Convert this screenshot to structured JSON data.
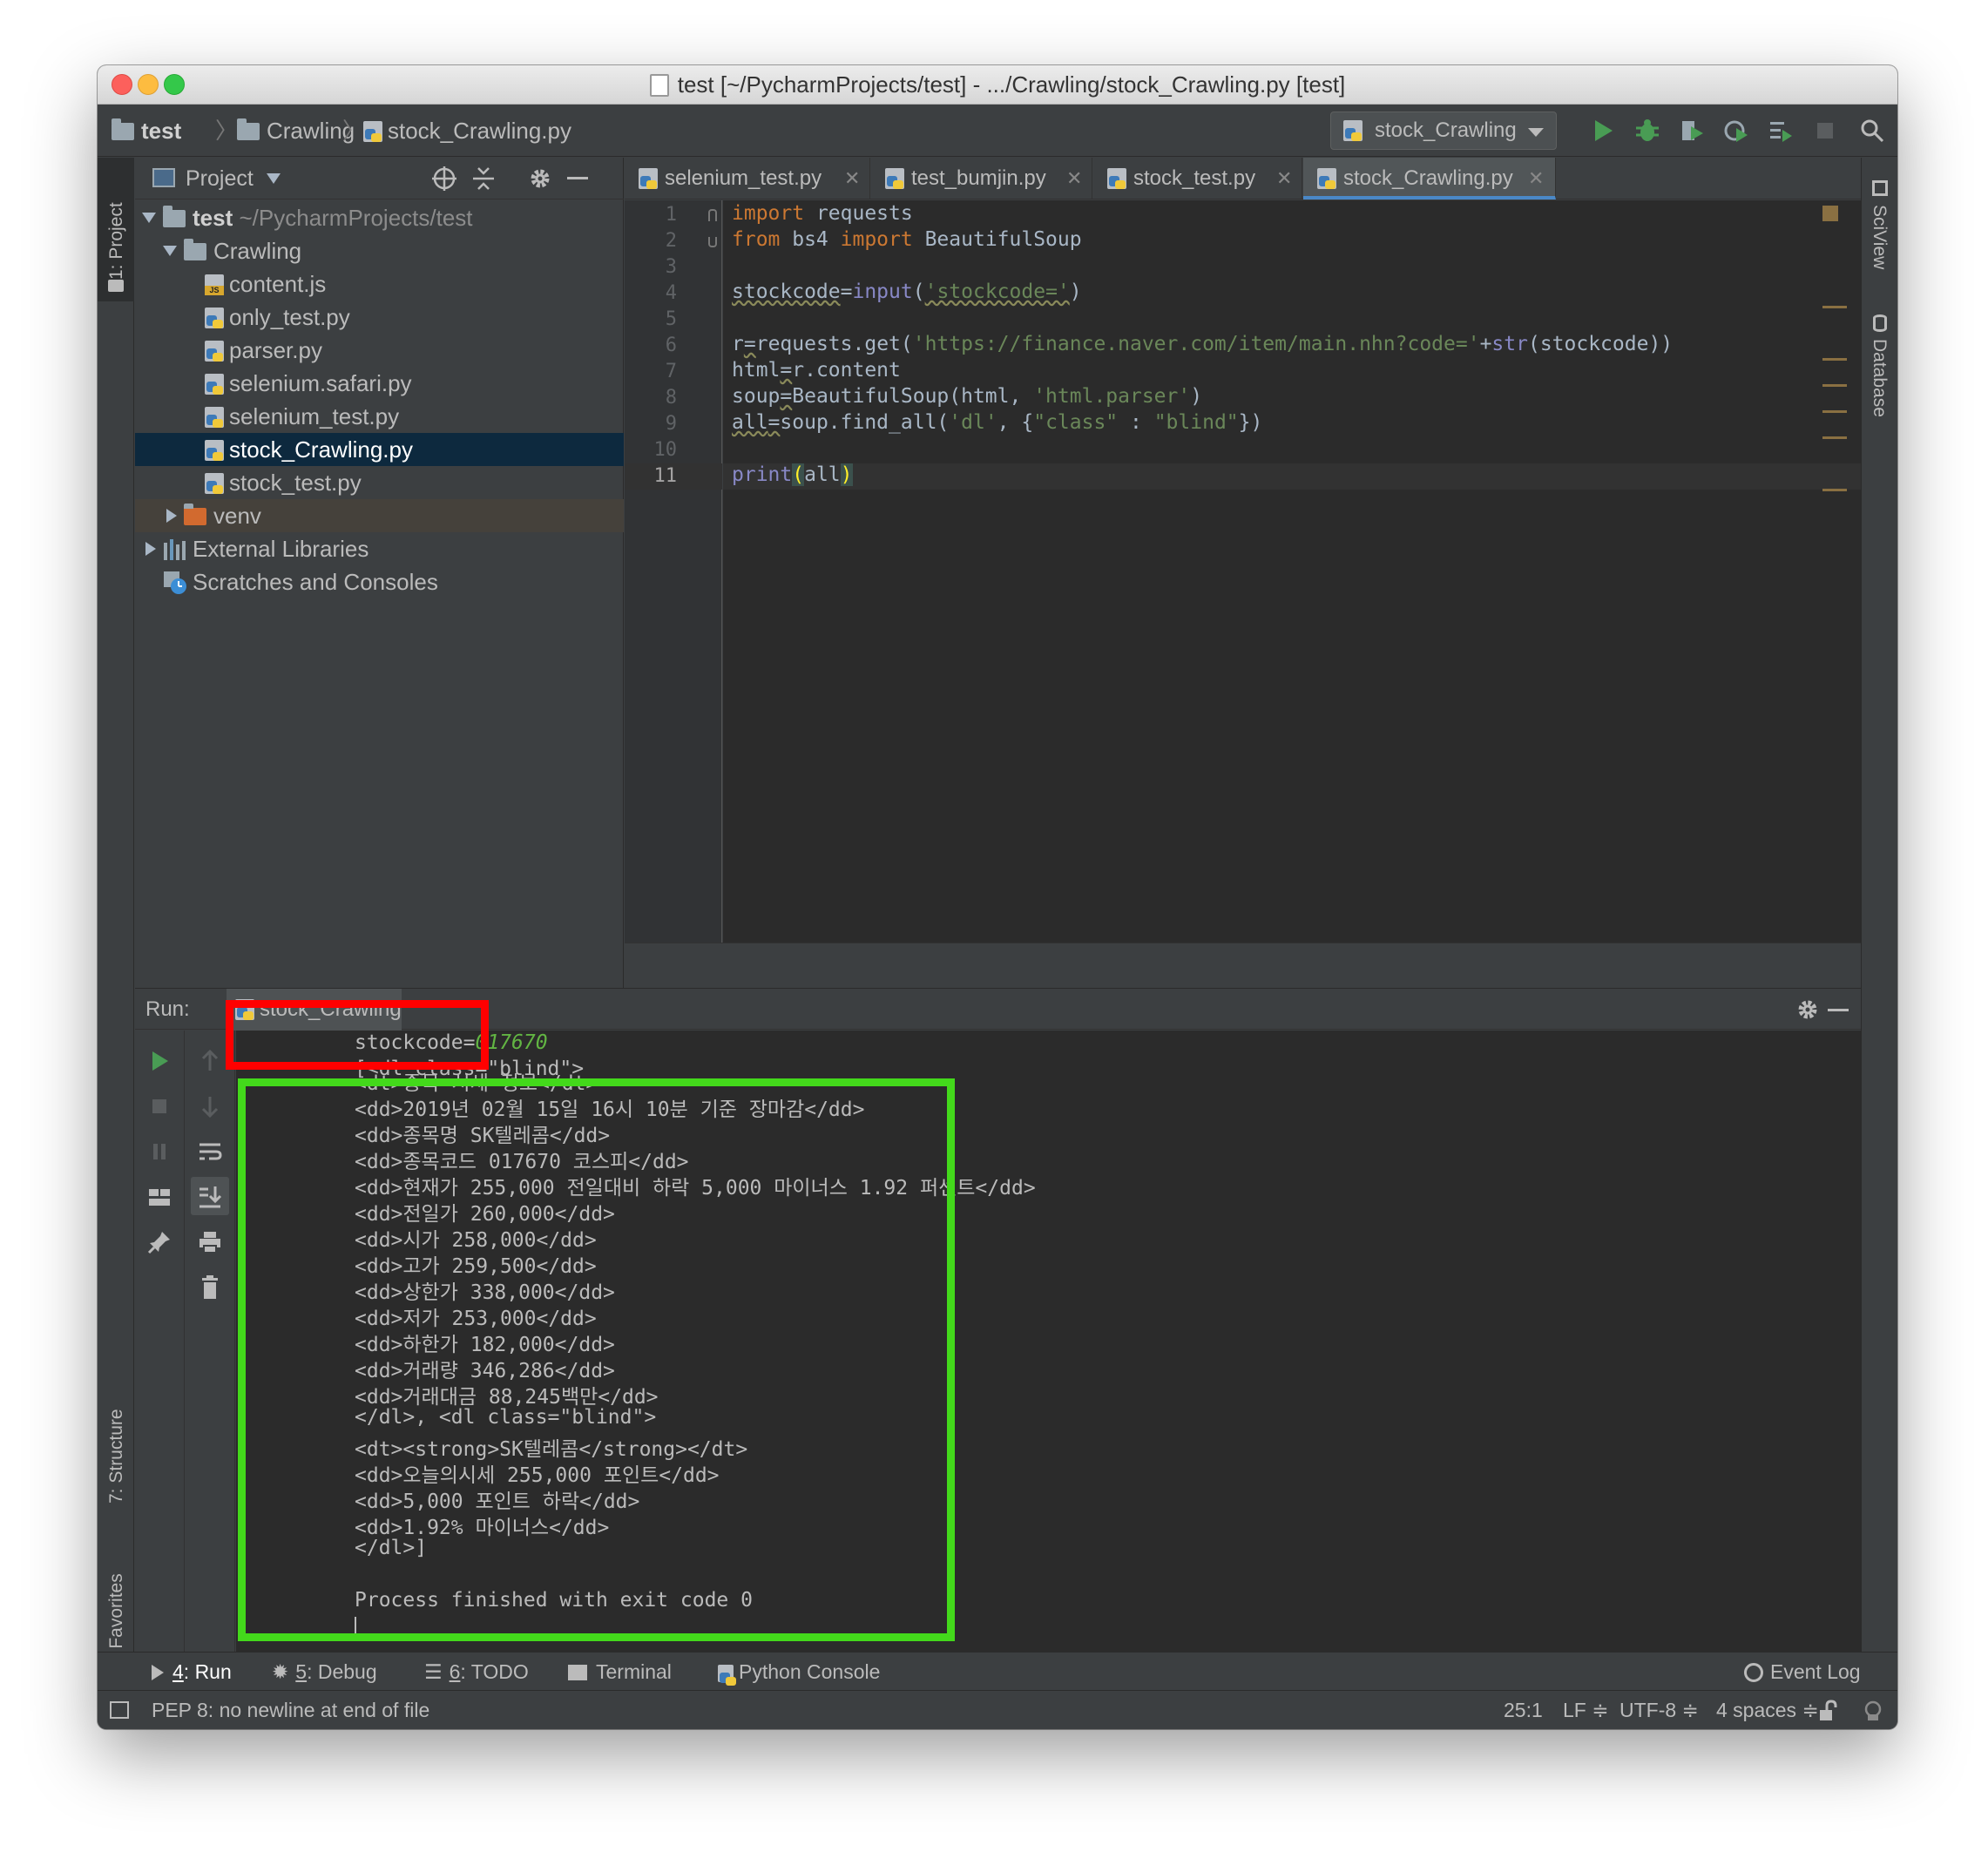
{
  "window": {
    "title": "test [~/PycharmProjects/test] - .../Crawling/stock_Crawling.py [test]"
  },
  "breadcrumb": [
    "test",
    "Crawling",
    "stock_Crawling.py"
  ],
  "run_config": "stock_Crawling",
  "side_tools": {
    "left_top": "1: Project",
    "left_structure": "7: Structure",
    "left_favorites": "2: Favorites",
    "right_sciview": "SciView",
    "right_database": "Database"
  },
  "project": {
    "header": "Project",
    "root_name": "test",
    "root_path": "~/PycharmProjects/test",
    "folder": "Crawling",
    "files": [
      "content.js",
      "only_test.py",
      "parser.py",
      "selenium.safari.py",
      "selenium_test.py",
      "stock_Crawling.py",
      "stock_test.py"
    ],
    "selected_file": "stock_Crawling.py",
    "venv": "venv",
    "external": "External Libraries",
    "scratches": "Scratches and Consoles"
  },
  "tabs": [
    "selenium_test.py",
    "test_bumjin.py",
    "stock_test.py",
    "stock_Crawling.py"
  ],
  "active_tab": "stock_Crawling.py",
  "editor": {
    "line_numbers": [
      "1",
      "2",
      "3",
      "4",
      "5",
      "6",
      "7",
      "8",
      "9",
      "10",
      "11"
    ],
    "current_line": 11,
    "code": {
      "l1": {
        "kw": "import",
        "rest": " requests"
      },
      "l2": {
        "kw1": "from",
        "mod": " bs4 ",
        "kw2": "import",
        "rest": " BeautifulSoup"
      },
      "l4": {
        "var": "stockcode",
        "eq": "=",
        "fn": "input",
        "open": "(",
        "str": "'stockcode='",
        "close": ")"
      },
      "l6": {
        "a": "r",
        "eq": "=",
        "b": "requests.get(",
        "str": "'https://finance.naver.com/item/main.nhn?code='",
        "plus": "+",
        "fn": "str",
        "c": "(stockcode))"
      },
      "l7": {
        "a": "html",
        "eq": "=",
        "b": "r.content"
      },
      "l8": {
        "a": "soup",
        "eq": "=",
        "b": "BeautifulSoup(html, ",
        "str": "'html.parser'",
        "c": ")"
      },
      "l9": {
        "a": "all",
        "eq": "=",
        "b": "soup.find_all(",
        "str1": "'dl'",
        "c": ", {",
        "str2": "\"class\"",
        "d": " : ",
        "str3": "\"blind\"",
        "e": "})"
      },
      "l11": {
        "fn": "print",
        "open": "(",
        "arg": "all",
        "close": ")"
      }
    }
  },
  "run": {
    "label": "Run:",
    "tab": "stock_Crawling",
    "prompt": "stockcode=",
    "input_value": "017670",
    "partial_line": "[<dl class=\"blind\">",
    "lines": [
      "<dt>종목 시세 정보</dt>",
      "<dd>2019년 02월 15일 16시 10분 기준 장마감</dd>",
      "<dd>종목명 SK텔레콤</dd>",
      "<dd>종목코드 017670 코스피</dd>",
      "<dd>현재가 255,000 전일대비 하락 5,000 마이너스 1.92 퍼센트</dd>",
      "<dd>전일가 260,000</dd>",
      "<dd>시가 258,000</dd>",
      "<dd>고가 259,500</dd>",
      "<dd>상한가 338,000</dd>",
      "<dd>저가 253,000</dd>",
      "<dd>하한가 182,000</dd>",
      "<dd>거래량 346,286</dd>",
      "<dd>거래대금 88,245백만</dd>",
      "</dl>, <dl class=\"blind\">",
      "<dt><strong>SK텔레콤</strong></dt>",
      "<dd>오늘의시세 255,000 포인트</dd>",
      "<dd>5,000 포인트 하락</dd>",
      "<dd>1.92% 마이너스</dd>",
      "</dl>]",
      "",
      "Process finished with exit code 0"
    ]
  },
  "bottom_tabs": {
    "run": {
      "num": "4",
      "text": ": Run"
    },
    "debug": {
      "num": "5",
      "text": ": Debug"
    },
    "todo": {
      "num": "6",
      "text": ": TODO"
    },
    "terminal": "Terminal",
    "python_console": "Python Console",
    "event_log": "Event Log"
  },
  "status": {
    "message": "PEP 8: no newline at end of file",
    "position": "25:1",
    "line_sep": "LF ≑",
    "encoding": "UTF-8 ≑",
    "indent": "4 spaces ≑"
  },
  "colors": {
    "highlight_red": "#ff0000",
    "highlight_green": "#43d91b",
    "selection": "#0d293e"
  }
}
